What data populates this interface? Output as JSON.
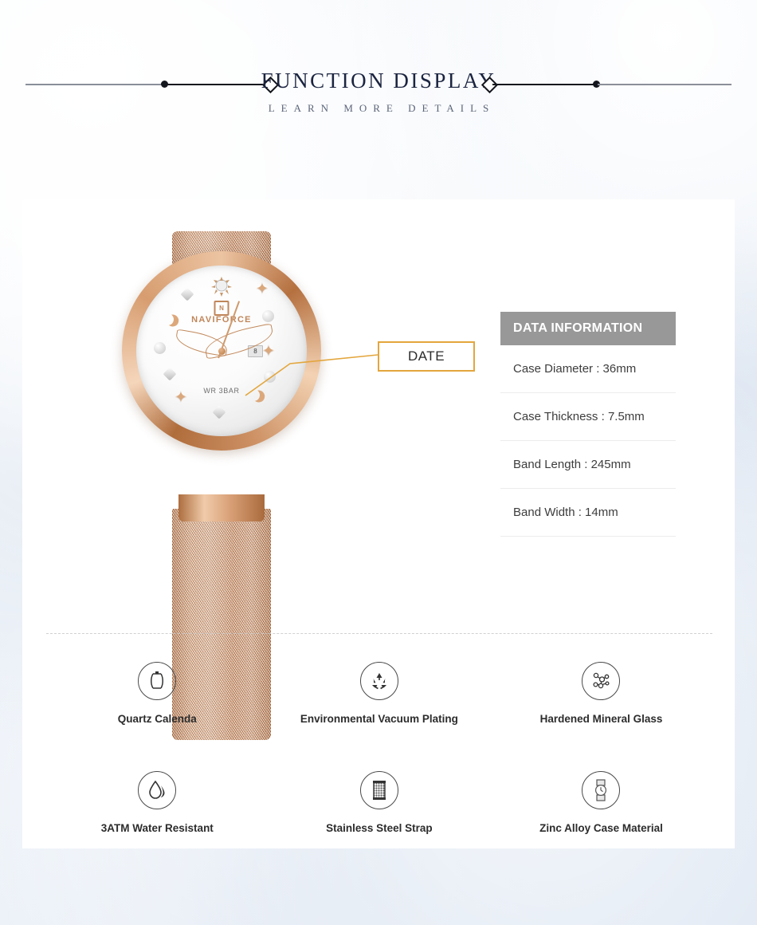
{
  "header": {
    "title": "FUNCTION  DISPLAY",
    "subtitle": "LEARN MORE DETAILS",
    "accent_color": "#1b2440"
  },
  "watch": {
    "brand": "NAVIFORCE",
    "logo_mark": "N",
    "water_resistance_text": "WR 3BAR",
    "date_value": "8",
    "case_color": "#d79d70",
    "dial_color": "#fbfbfb"
  },
  "callout": {
    "label": "DATE",
    "border_color": "#e3a63c"
  },
  "spec_panel": {
    "heading": "DATA INFORMATION",
    "heading_bg": "#989898",
    "rows": [
      {
        "text": "Case Diameter : 36mm"
      },
      {
        "text": "Case Thickness : 7.5mm"
      },
      {
        "text": "Band Length : 245mm"
      },
      {
        "text": "Band Width : 14mm"
      }
    ]
  },
  "features": [
    {
      "icon": "watch-case-outline-icon",
      "label": "Quartz Calenda"
    },
    {
      "icon": "recycle-icon",
      "label": "Environmental Vacuum Plating"
    },
    {
      "icon": "molecule-icon",
      "label": "Hardened Mineral Glass"
    },
    {
      "icon": "water-drop-icon",
      "label": "3ATM Water Resistant"
    },
    {
      "icon": "mesh-strap-icon",
      "label": "Stainless Steel Strap"
    },
    {
      "icon": "wristwatch-icon",
      "label": "Zinc Alloy Case Material"
    }
  ]
}
